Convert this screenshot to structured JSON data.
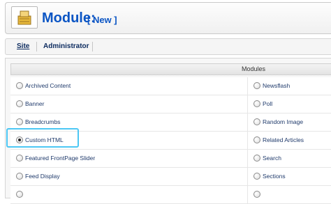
{
  "header": {
    "title": "Module:",
    "subtitle": "[ New ]",
    "icon": "module-icon"
  },
  "submenu": {
    "tabs": [
      {
        "label": "Site",
        "active": true
      },
      {
        "label": "Administrator",
        "active": false
      }
    ]
  },
  "table": {
    "header": "Modules",
    "rows": [
      {
        "left": "Archived Content",
        "right": "Newsflash",
        "left_checked": false
      },
      {
        "left": "Banner",
        "right": "Poll",
        "left_checked": false
      },
      {
        "left": "Breadcrumbs",
        "right": "Random Image",
        "left_checked": false
      },
      {
        "left": "Custom HTML",
        "right": "Related Articles",
        "left_checked": true
      },
      {
        "left": "Featured FrontPage Slider",
        "right": "Search",
        "left_checked": false
      },
      {
        "left": "Feed Display",
        "right": "Sections",
        "left_checked": false
      },
      {
        "left": "",
        "right": "",
        "left_checked": false
      }
    ]
  },
  "colors": {
    "title": "#0b55c4",
    "highlight": "#4cc7f4"
  }
}
